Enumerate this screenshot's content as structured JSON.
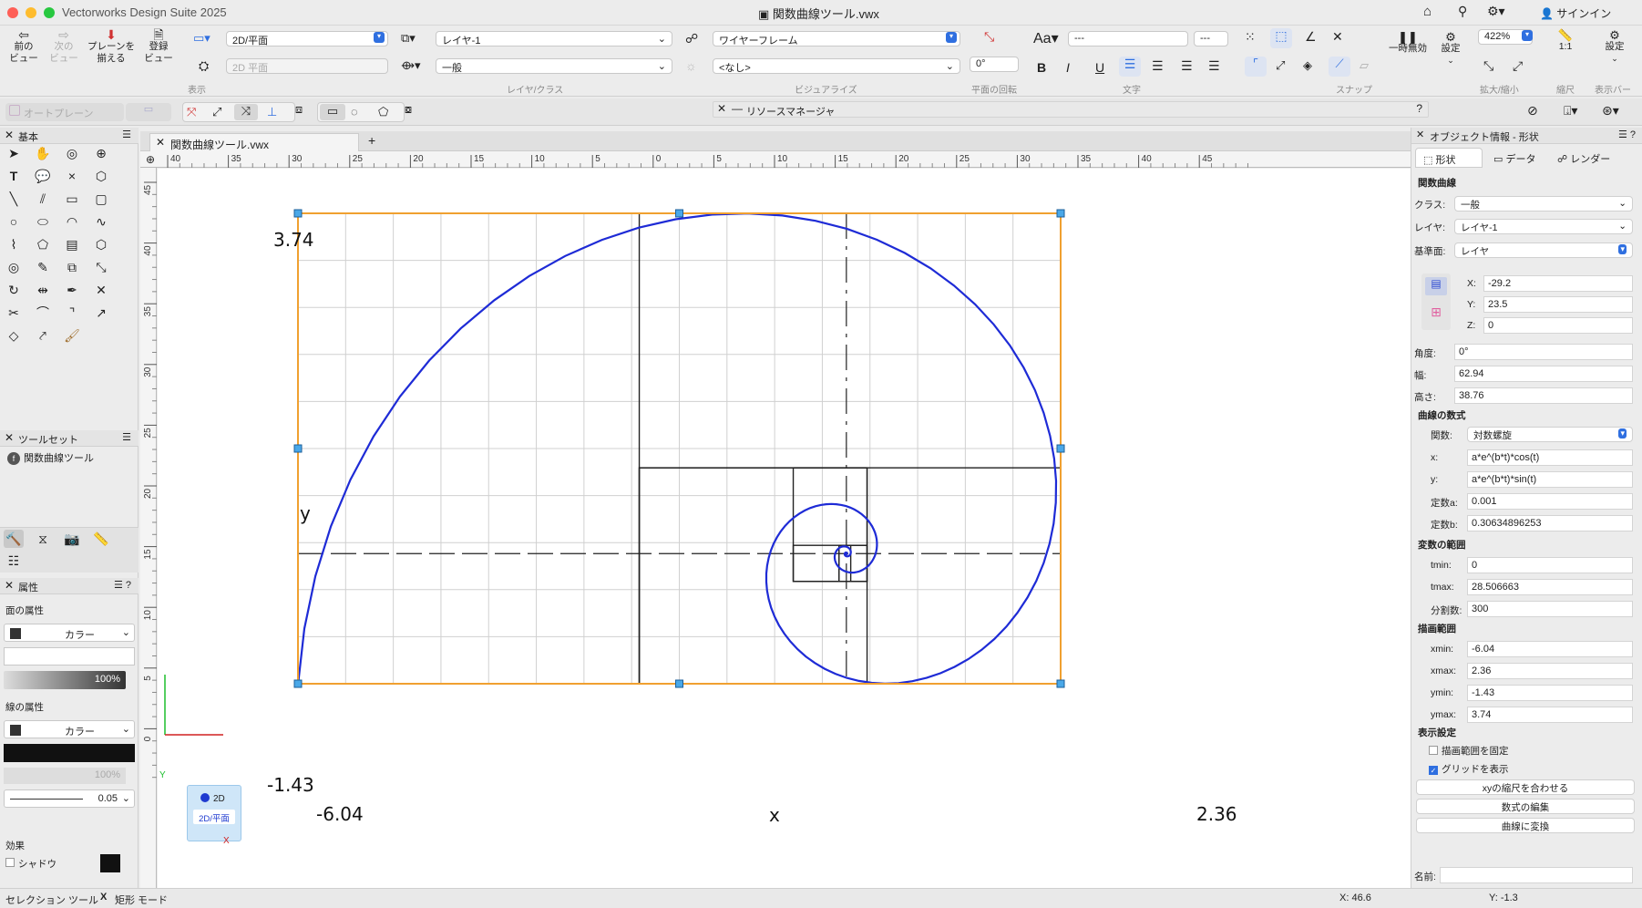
{
  "window": {
    "title": "Vectorworks Design Suite 2025",
    "doc_title": "関数曲線ツール.vwx",
    "signin": "サインイン"
  },
  "toolbar": {
    "prev_view": "前の\nビュー",
    "next_view": "次の\nビュー",
    "align_plane": "プレーンを\n揃える",
    "saved_view": "登録\nビュー",
    "view_select": "2D/平面",
    "plane_select": "2D 平面",
    "layer_select": "レイヤ-1",
    "class_select": "一般",
    "render_select": "ワイヤーフレーム",
    "none_select": "<なし>",
    "rotation": "0°",
    "font_select": "---",
    "size_select": "---",
    "pause_label": "一時無効",
    "settings_label": "設定",
    "zoom": "422%",
    "scale_label": "1:1",
    "settings2_label": "設定",
    "group_view": "表示",
    "group_layer": "レイヤ/クラス",
    "group_visualize": "ビジュアライズ",
    "group_rotation": "平面の回転",
    "group_text": "文字",
    "group_snap": "スナップ",
    "group_zoom": "拡大/縮小",
    "group_scale": "縮尺",
    "group_displaybar": "表示バー"
  },
  "modebar": {
    "auto_plane": "オートプレーン",
    "resource_manager": "リソースマネージャ"
  },
  "basic_palette": {
    "title": "基本"
  },
  "toolsets": {
    "title": "ツールセット",
    "item": "関数曲線ツール"
  },
  "attributes": {
    "title": "属性",
    "fill_label": "面の属性",
    "fill_type": "カラー",
    "fill_opacity": "100%",
    "line_label": "線の属性",
    "line_type": "カラー",
    "line_opacity": "100%",
    "line_weight": "0.05",
    "effects_label": "効果",
    "shadow_label": "シャドウ"
  },
  "document": {
    "tab": "関数曲線ツール.vwx"
  },
  "ruler": {
    "top": [
      "40",
      "35",
      "30",
      "25",
      "20",
      "15",
      "10",
      "5",
      "0",
      "5",
      "10",
      "15",
      "20",
      "25",
      "30",
      "35",
      "40",
      "45"
    ],
    "left": [
      "45",
      "40",
      "35",
      "30",
      "25",
      "20",
      "15",
      "10",
      "5",
      "0"
    ]
  },
  "drawing": {
    "y_max": "3.74",
    "y_min": "-1.43",
    "x_min": "-6.04",
    "x_max": "2.36",
    "x_label": "x",
    "y_label": "y",
    "view_badge_top": "2D",
    "view_badge_bottom": "2D/平面",
    "axis_x": "X",
    "axis_y": "Y"
  },
  "oip": {
    "title": "オブジェクト情報 - 形状",
    "tabs": [
      "形状",
      "データ",
      "レンダー"
    ],
    "object_type": "関数曲線",
    "class_label": "クラス:",
    "class_value": "一般",
    "layer_label": "レイヤ:",
    "layer_value": "レイヤ-1",
    "plane_label": "基準面:",
    "plane_value": "レイヤ",
    "x_label": "X:",
    "x_value": "-29.2",
    "y_label": "Y:",
    "y_value": "23.5",
    "z_label": "Z:",
    "z_value": "0",
    "angle_label": "角度:",
    "angle_value": "0°",
    "width_label": "幅:",
    "width_value": "62.94",
    "height_label": "高さ:",
    "height_value": "38.76",
    "formula_header": "曲線の数式",
    "func_label": "関数:",
    "func_value": "対数螺旋",
    "fx_label": "x:",
    "fx_value": "a*e^(b*t)*cos(t)",
    "fy_label": "y:",
    "fy_value": "a*e^(b*t)*sin(t)",
    "ca_label": "定数a:",
    "ca_value": "0.001",
    "cb_label": "定数b:",
    "cb_value": "0.30634896253",
    "range_header": "変数の範囲",
    "tmin_label": "tmin:",
    "tmin_value": "0",
    "tmax_label": "tmax:",
    "tmax_value": "28.506663",
    "div_label": "分割数:",
    "div_value": "300",
    "draw_header": "描画範囲",
    "xmin_label": "xmin:",
    "xmin_value": "-6.04",
    "xmax_label": "xmax:",
    "xmax_value": "2.36",
    "ymin_label": "ymin:",
    "ymin_value": "-1.43",
    "ymax_label": "ymax:",
    "ymax_value": "3.74",
    "display_header": "表示設定",
    "fix_range": "描画範囲を固定",
    "show_grid": "グリッドを表示",
    "btn_match": "xyの縮尺を合わせる",
    "btn_edit": "数式の編集",
    "btn_convert": "曲線に変換",
    "name_label": "名前:"
  },
  "status": {
    "tool": "セレクション ツール",
    "mode": "矩形 モード",
    "x_coord": "X: 46.6",
    "y_coord": "Y: -1.3"
  },
  "colors": {
    "curve": "#1e2bd6",
    "frame": "#f0a030",
    "handle": "#4aa8e8",
    "accent": "#2f6fe0"
  }
}
